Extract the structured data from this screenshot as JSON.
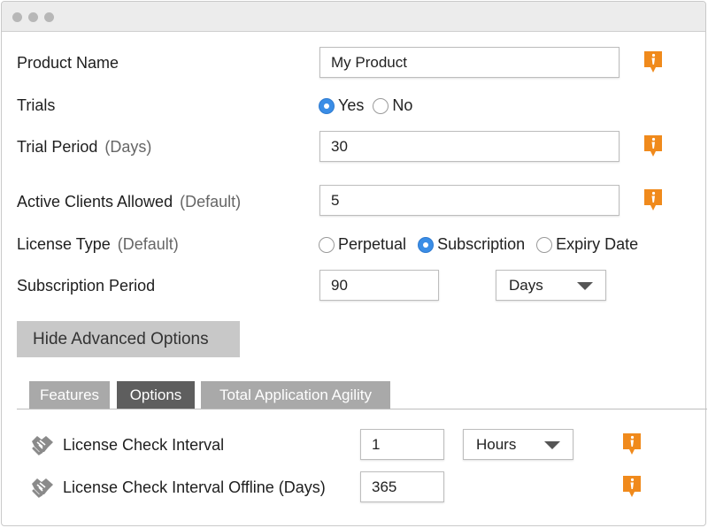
{
  "fields": {
    "product_name": {
      "label": "Product Name",
      "value": "My Product"
    },
    "trials": {
      "label": "Trials",
      "options": [
        "Yes",
        "No"
      ],
      "selected": "Yes"
    },
    "trial_period": {
      "label": "Trial Period",
      "hint": "(Days)",
      "value": "30"
    },
    "active_clients": {
      "label": "Active Clients Allowed",
      "hint": "(Default)",
      "value": "5"
    },
    "license_type": {
      "label": "License Type",
      "hint": "(Default)",
      "options": [
        "Perpetual",
        "Subscription",
        "Expiry Date"
      ],
      "selected": "Subscription"
    },
    "subscription_period": {
      "label": "Subscription Period",
      "value": "90",
      "unit": "Days"
    }
  },
  "advanced_button": {
    "label": "Hide Advanced Options"
  },
  "tabs": [
    {
      "label": "Features",
      "active": false
    },
    {
      "label": "Options",
      "active": true
    },
    {
      "label": "Total Application Agility",
      "active": false
    }
  ],
  "options_panel": {
    "check_interval": {
      "label": "License Check Interval",
      "value": "1",
      "unit": "Hours"
    },
    "check_interval_offline": {
      "label": "License Check Interval Offline (Days)",
      "value": "365"
    }
  },
  "colors": {
    "info_icon": "#f08a1c",
    "radio_selected": "#3a8de6",
    "tab_active": "#5e5e5e",
    "tab_inactive": "#a9a9a9",
    "button_bg": "#c8c8c8"
  },
  "icons": {
    "info": "info-icon",
    "handshake": "handshake-icon",
    "caret": "chevron-down-icon"
  }
}
